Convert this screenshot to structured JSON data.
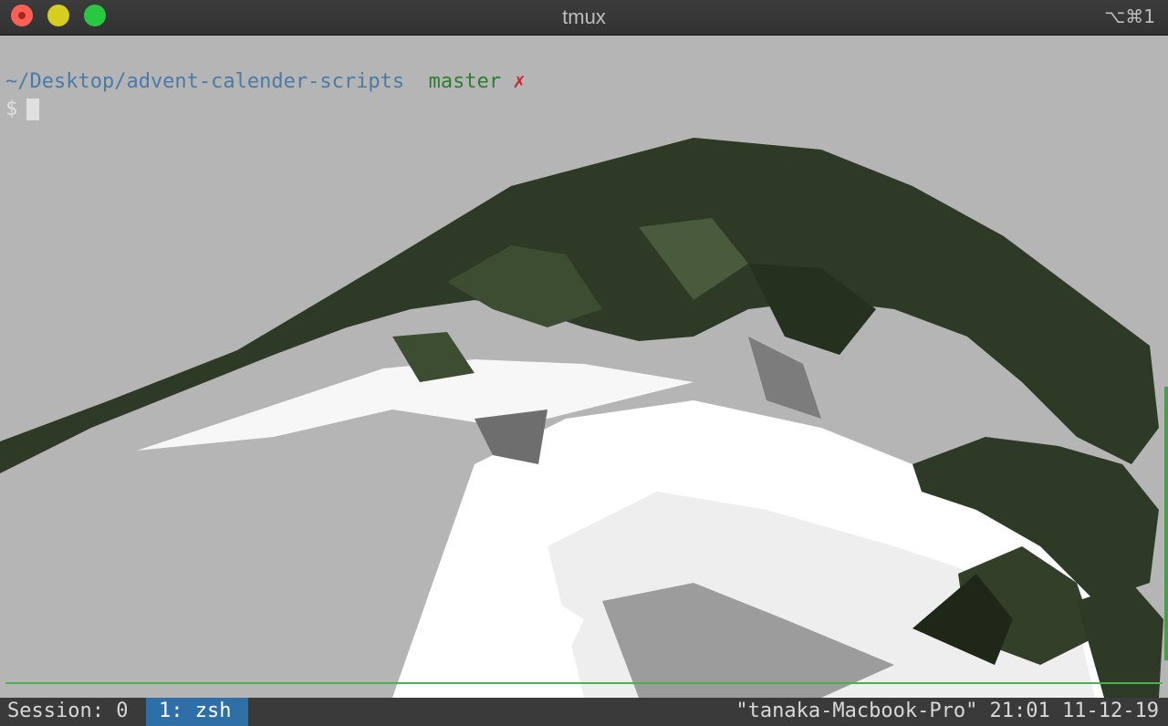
{
  "window": {
    "title": "tmux",
    "shortcut": "⌥⌘1",
    "colors": {
      "close": "#fe5f57",
      "minimize": "#d6cd21",
      "zoom": "#28c840"
    }
  },
  "terminal": {
    "prompt": {
      "path": "~/Desktop/advent-calender-scripts",
      "branch": "master",
      "dirty_marker": "✗",
      "symbol": "$"
    },
    "colors": {
      "path": "#4a7ba8",
      "branch": "#2e7d32",
      "dirty": "#c62828",
      "divider": "#4caf50"
    }
  },
  "statusbar": {
    "session": "Session: 0",
    "active_window": "1: zsh",
    "host_info": "\"tanaka-Macbook-Pro\" 21:01 11-12-19",
    "colors": {
      "background": "#3a3a3a",
      "active_tab": "#2f6fa8"
    }
  }
}
